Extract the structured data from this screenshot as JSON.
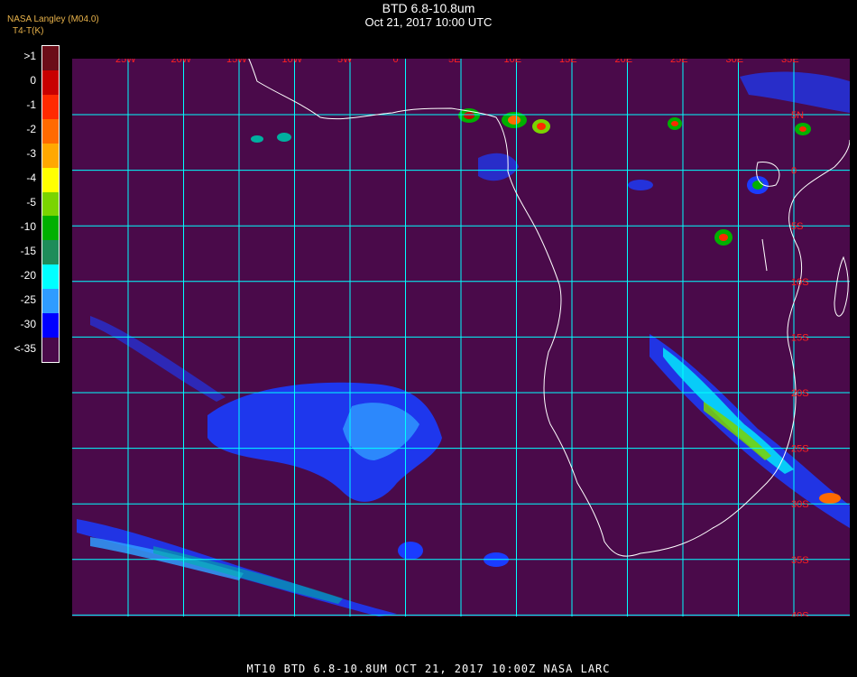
{
  "header": {
    "title": "BTD 6.8-10.8um",
    "subtitle": "Oct 21, 2017 10:00 UTC",
    "credit": "NASA Langley (M04.0)",
    "overlay_label": "BTD",
    "units_label": "T4-T(K)"
  },
  "legend": {
    "labels": [
      ">1",
      "0",
      "-1",
      "-2",
      "-3",
      "-4",
      "-5",
      "-10",
      "-15",
      "-20",
      "-25",
      "-30",
      "<-35"
    ],
    "colors": [
      "#6b0d18",
      "#c80000",
      "#ff2a00",
      "#ff6a00",
      "#ffa800",
      "#ffff00",
      "#7ad400",
      "#00b000",
      "#1e8c5a",
      "#00ffff",
      "#2f9cff",
      "#0000ff",
      "#4a0a4a"
    ]
  },
  "map": {
    "background": "#4a0a4a",
    "grid_color": "#00ffff",
    "coast_color": "#ffffff",
    "lon_labels": [
      "25W",
      "20W",
      "15W",
      "10W",
      "5W",
      "0",
      "5E",
      "10E",
      "15E",
      "20E",
      "25E",
      "30E",
      "35E"
    ],
    "lat_labels": [
      "5N",
      "0",
      "5S",
      "10S",
      "15S",
      "20S",
      "25S",
      "30S",
      "35S",
      "40S"
    ],
    "label_color": "#ff2020"
  },
  "footer": {
    "text": "MT10  BTD 6.8-10.8UM   OCT 21, 2017 10:00Z   NASA LARC"
  }
}
